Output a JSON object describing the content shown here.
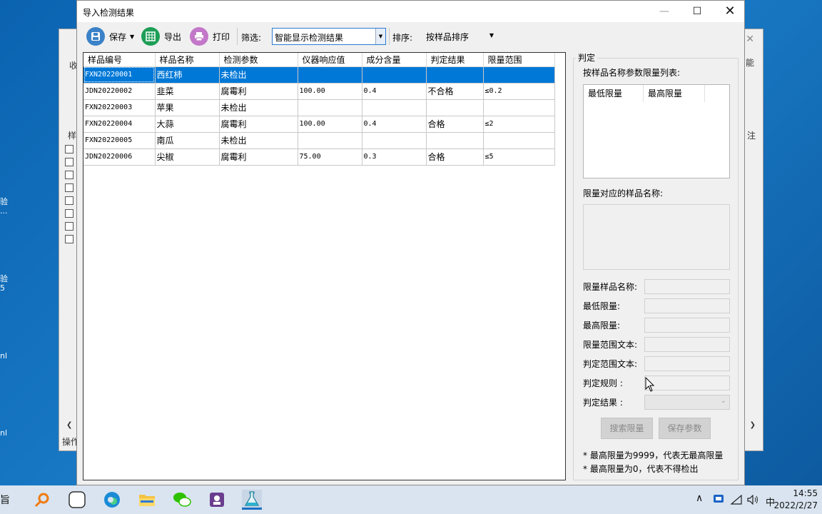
{
  "desktop": {
    "labels": [
      "验\n...",
      "验\n5",
      "nl",
      "nl"
    ]
  },
  "background_window": {
    "tab_left": "收",
    "tab_right": "能",
    "col_left": "样",
    "col_right": "注",
    "status": "操作"
  },
  "dialog": {
    "title": "导入检测结果",
    "toolbar": {
      "save_label": "保存",
      "export_label": "导出",
      "print_label": "打印",
      "filter_label": "筛选:",
      "filter_value": "智能显示检测结果",
      "sort_label": "排序:",
      "sort_value": "按样品排序"
    },
    "table": {
      "columns": [
        "样品编号",
        "样品名称",
        "检测参数",
        "仪器响应值",
        "成分含量",
        "判定结果",
        "限量范围"
      ],
      "rows": [
        {
          "id": "FXN20220001",
          "name": "西红柿",
          "param": "未检出",
          "response": "",
          "content": "",
          "result": "",
          "limit": "",
          "selected": true
        },
        {
          "id": "JDN20220002",
          "name": "韭菜",
          "param": "腐霉利",
          "response": "100.00",
          "content": "0.4",
          "result": "不合格",
          "limit": "≤0.2",
          "selected": false
        },
        {
          "id": "FXN20220003",
          "name": "苹果",
          "param": "未检出",
          "response": "",
          "content": "",
          "result": "",
          "limit": "",
          "selected": false
        },
        {
          "id": "FXN20220004",
          "name": "大蒜",
          "param": "腐霉利",
          "response": "100.00",
          "content": "0.4",
          "result": "合格",
          "limit": "≤2",
          "selected": false
        },
        {
          "id": "FXN20220005",
          "name": "南瓜",
          "param": "未检出",
          "response": "",
          "content": "",
          "result": "",
          "limit": "",
          "selected": false
        },
        {
          "id": "JDN20220006",
          "name": "尖椒",
          "param": "腐霉利",
          "response": "75.00",
          "content": "0.3",
          "result": "合格",
          "limit": "≤5",
          "selected": false
        }
      ]
    },
    "panel": {
      "title": "判定",
      "limit_list_label": "按样品名称参数限量列表:",
      "limit_list_cols": [
        "最低限量",
        "最高限量"
      ],
      "sample_names_label": "限量对应的样品名称:",
      "fields": {
        "sample_name": "限量样品名称:",
        "min_limit": "最低限量:",
        "max_limit": "最高限量:",
        "limit_text": "限量范围文本:",
        "judge_text": "判定范围文本:",
        "judge_rule": "判定规则 :",
        "judge_result": "判定结果 :"
      },
      "search_button": "搜索限量",
      "save_button": "保存参数",
      "notes": [
        "* 最高限量为9999，代表无最高限量",
        "* 最高限量为0，代表不得检出"
      ]
    }
  },
  "taskbar": {
    "left_fragment": "旨",
    "ime": "中",
    "time": "14:55",
    "date": "2022/2/27"
  }
}
